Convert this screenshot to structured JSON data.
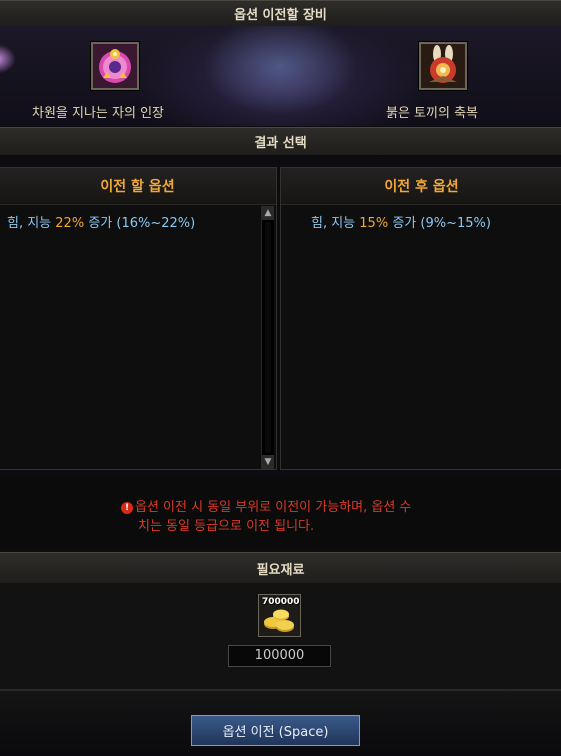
{
  "header": {
    "title": "옵션 이전할 장비"
  },
  "equipment": {
    "left": {
      "name": "차원을 지나는 자의 인장",
      "icon": "pink-medallion-icon"
    },
    "right": {
      "name": "붉은 토끼의 축복",
      "icon": "red-rabbit-charm-icon"
    }
  },
  "result": {
    "title": "결과 선택"
  },
  "before": {
    "title": "이전 할 옵션",
    "option": {
      "prefix": "힘, 지능 ",
      "value": "22%",
      "suffix": " 증가 (16%~22%)"
    }
  },
  "after": {
    "title": "이전 후 옵션",
    "option": {
      "prefix": "힘, 지능 ",
      "value": "15%",
      "suffix": " 증가 (9%~15%)"
    }
  },
  "notice": {
    "icon": "warning-icon",
    "line1": "옵션 이전 시 동일 부위로 이전이 가능하며, 옵션 수",
    "line2": "치는 동일 등급으로 이전 됩니다."
  },
  "material": {
    "title": "필요재료",
    "icon": "gold-coins-icon",
    "count_label": "700000",
    "quantity": "100000"
  },
  "footer": {
    "button_label": "옵션 이전 (Space)"
  },
  "colors": {
    "option_text": "#8cc8f0",
    "highlight": "#f0a838",
    "warning": "#d83a28"
  }
}
